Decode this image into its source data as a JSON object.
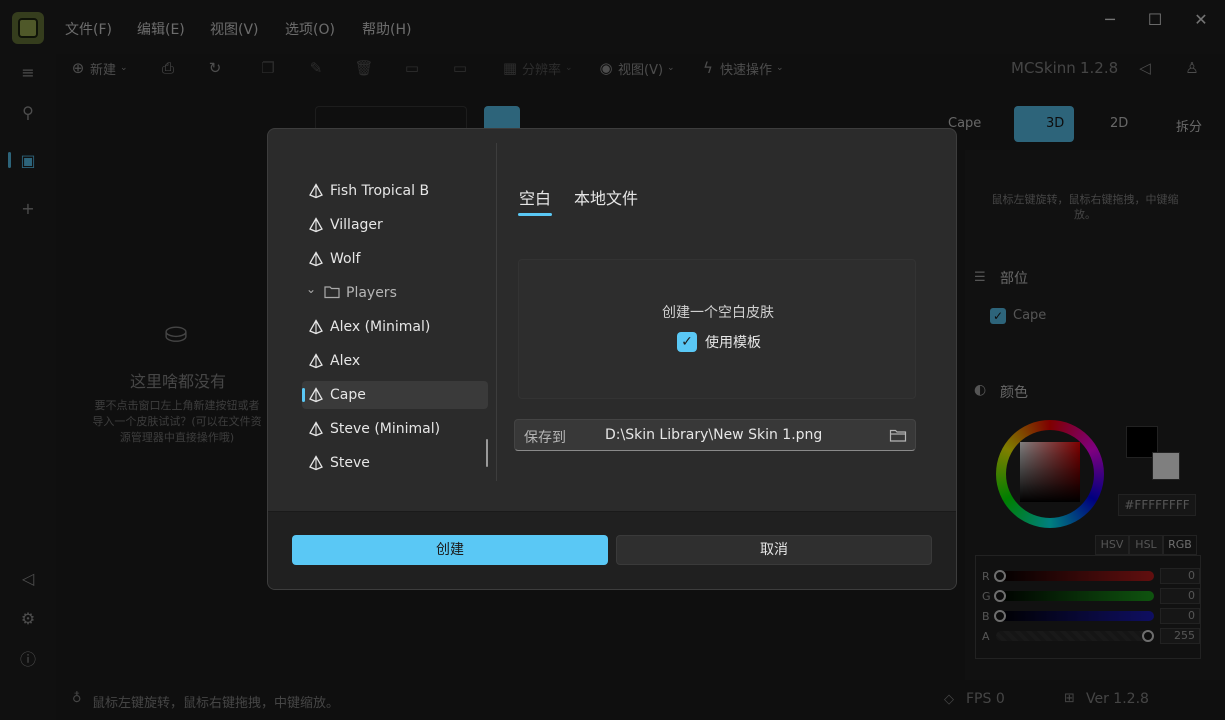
{
  "menu": [
    "文件(F)",
    "编辑(E)",
    "视图(V)",
    "选项(O)",
    "帮助(H)"
  ],
  "window_controls": {
    "minimize": "─",
    "maximize": "☐",
    "close": "✕"
  },
  "toolbar": {
    "new_label": "新建",
    "resolution_label": "分辨率",
    "view_label": "视图(V)",
    "quick_ops_label": "快速操作",
    "app_name": "MCSkinn",
    "version": "1.2.8"
  },
  "editor_toolbar": {
    "cape_label": "Cape",
    "mode_3d": "3D",
    "mode_2d": "2D",
    "split_label": "拆分"
  },
  "left_panel": {
    "empty_title": "这里啥都没有",
    "empty_desc": "要不点击窗口左上角新建按钮或者导入一个皮肤试试？(可以在文件资源管理器中直接操作哦)"
  },
  "right_panel": {
    "hint": "鼠标左键旋转，鼠标右键拖拽，中键缩放。",
    "parts_title": "部位",
    "cape_part": "Cape",
    "color_title": "颜色",
    "hex": "#FFFFFFFF",
    "color_modes": [
      "HSV",
      "HSL",
      "RGB"
    ],
    "channels": [
      {
        "label": "R",
        "value": "0",
        "color": "#c41e1e"
      },
      {
        "label": "G",
        "value": "0",
        "color": "#1ea81e"
      },
      {
        "label": "B",
        "value": "0",
        "color": "#1e1ec4"
      },
      {
        "label": "A",
        "value": "255",
        "color": "#555555"
      }
    ]
  },
  "status": {
    "hint": "鼠标左键旋转，鼠标右键拖拽，中键缩放。",
    "fps": "FPS 0",
    "ver": "Ver 1.2.8"
  },
  "dialog": {
    "tree": {
      "items": [
        {
          "label": "Fish Tropical B",
          "type": "model"
        },
        {
          "label": "Villager",
          "type": "model"
        },
        {
          "label": "Wolf",
          "type": "model"
        },
        {
          "label": "Players",
          "type": "folder"
        },
        {
          "label": "Alex (Minimal)",
          "type": "model"
        },
        {
          "label": "Alex",
          "type": "model"
        },
        {
          "label": "Cape",
          "type": "model",
          "selected": true
        },
        {
          "label": "Steve (Minimal)",
          "type": "model"
        },
        {
          "label": "Steve",
          "type": "model"
        }
      ]
    },
    "tabs": [
      "空白",
      "本地文件"
    ],
    "blank_title": "创建一个空白皮肤",
    "use_template_label": "使用模板",
    "save_to_label": "保存到",
    "save_path": "D:\\Skin Library\\New Skin 1.png",
    "create_button": "创建",
    "cancel_button": "取消"
  },
  "colors": {
    "accent": "#5ac8f5",
    "bg": "#1f1f1f",
    "dialog": "#2b2b2b"
  }
}
